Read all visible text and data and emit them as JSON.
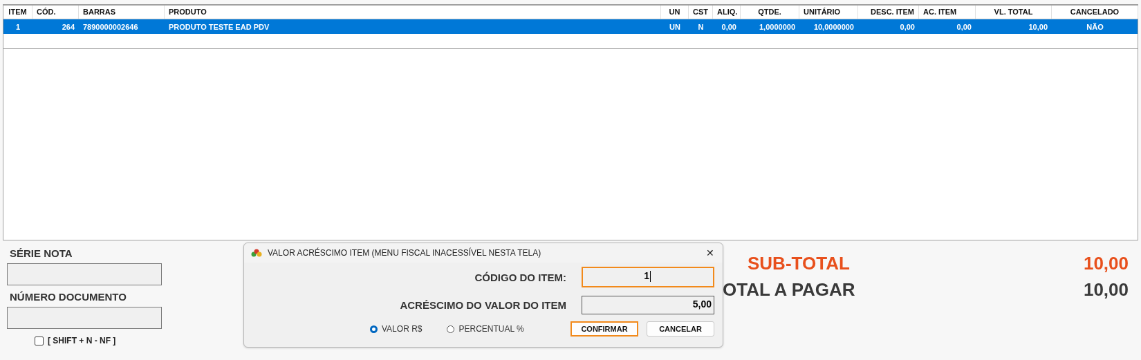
{
  "table": {
    "columns": [
      "ITEM",
      "CÓD.",
      "BARRAS",
      "PRODUTO",
      "UN",
      "CST",
      "ALIQ.",
      "QTDE.",
      "UNITÁRIO",
      "DESC. ITEM",
      "AC. ITEM",
      "VL. TOTAL",
      "CANCELADO"
    ],
    "rows": [
      {
        "selected": true,
        "cells": [
          "1",
          "264",
          "7890000002646",
          "PRODUTO TESTE EAD PDV",
          "UN",
          "N",
          "0,00",
          "1,0000000",
          "10,0000000",
          "0,00",
          "0,00",
          "10,00",
          "NÃO"
        ]
      }
    ]
  },
  "left_panel": {
    "serie_label": "SÉRIE NOTA",
    "numero_label": "NÚMERO DOCUMENTO",
    "checkbox": {
      "label": "[ SHIFT + N - NF ]",
      "checked": false
    }
  },
  "dialog": {
    "title": "VALOR ACRÉSCIMO ITEM (MENU FISCAL INACESSÍVEL NESTA TELA)",
    "close": "✕",
    "fields": [
      {
        "label": "CÓDIGO DO ITEM:",
        "value": "1",
        "focused": true
      },
      {
        "label": "ACRÉSCIMO DO VALOR DO ITEM",
        "value": "5,00",
        "focused": false
      }
    ],
    "options": [
      {
        "label": "VALOR R$",
        "selected": true
      },
      {
        "label": "PERCENTUAL %",
        "selected": false
      }
    ],
    "buttons": [
      {
        "label": "CONFIRMAR",
        "focused": true
      },
      {
        "label": "CANCELAR",
        "focused": false
      }
    ]
  },
  "totals": [
    {
      "kind": "subtotal",
      "label": "SUB-TOTAL",
      "value": "10,00"
    },
    {
      "kind": "total",
      "label": "OTAL A PAGAR",
      "value": "10,00"
    }
  ]
}
